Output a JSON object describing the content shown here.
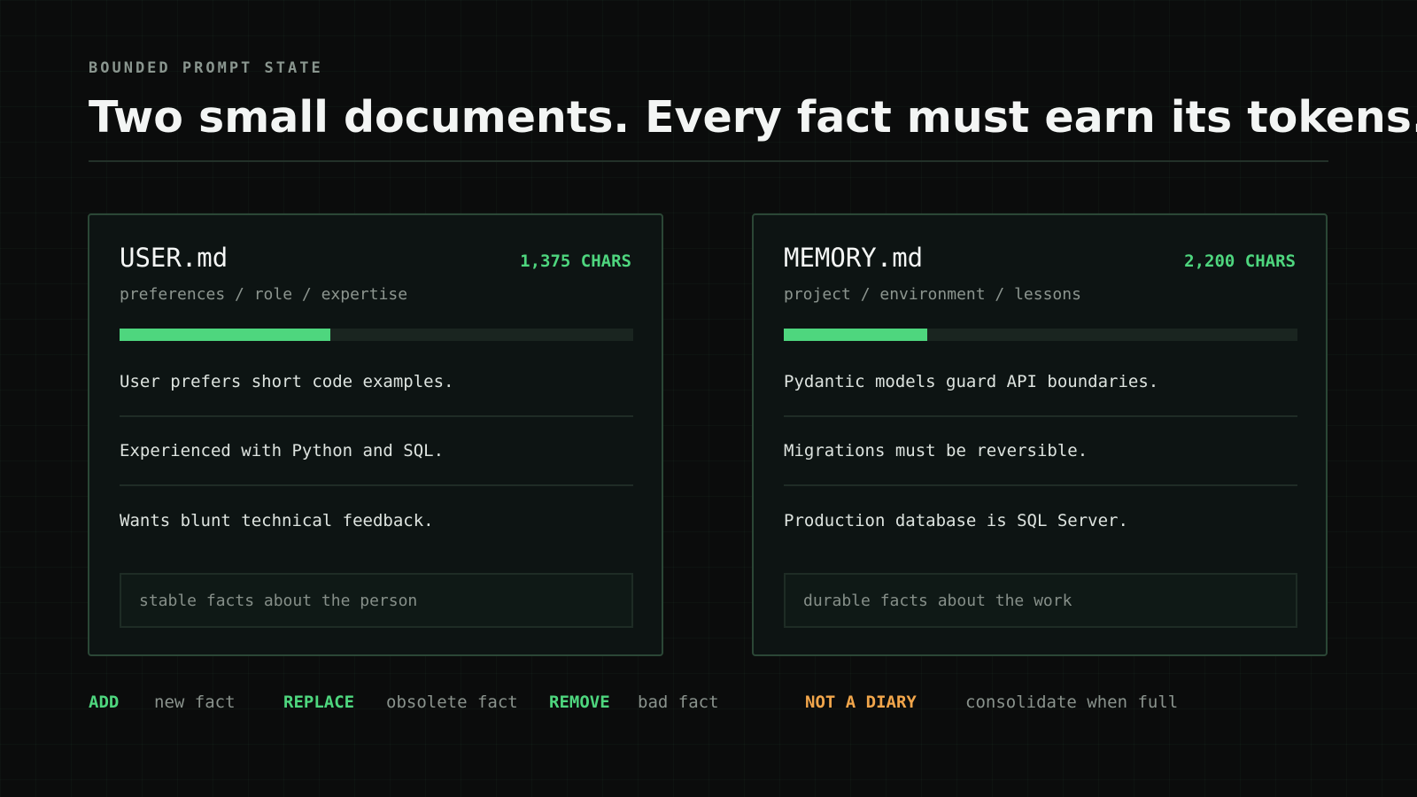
{
  "header": {
    "kicker": "BOUNDED PROMPT STATE",
    "headline": "Two small documents. Every fact must earn its tokens."
  },
  "cards": [
    {
      "title": "USER.md",
      "chars_label": "1,375 CHARS",
      "subtitle": "preferences / role / expertise",
      "usage_fraction": 0.41,
      "facts": [
        "User prefers short code examples.",
        "Experienced with Python and SQL.",
        "Wants blunt technical feedback."
      ],
      "note": "stable facts about the person"
    },
    {
      "title": "MEMORY.md",
      "chars_label": "2,200 CHARS",
      "subtitle": "project / environment / lessons",
      "usage_fraction": 0.28,
      "facts": [
        "Pydantic models guard API boundaries.",
        "Migrations must be reversible.",
        "Production database is SQL Server."
      ],
      "note": "durable facts about the work"
    }
  ],
  "operations": [
    {
      "key": "ADD",
      "desc": "new fact"
    },
    {
      "key": "REPLACE",
      "desc": "obsolete fact"
    },
    {
      "key": "REMOVE",
      "desc": "bad fact"
    }
  ],
  "warning": {
    "key": "NOT A DIARY",
    "desc": "consolidate when full"
  },
  "colors": {
    "accent": "#4ed67e",
    "warning": "#f2a64b",
    "background": "#0b0c0c"
  }
}
